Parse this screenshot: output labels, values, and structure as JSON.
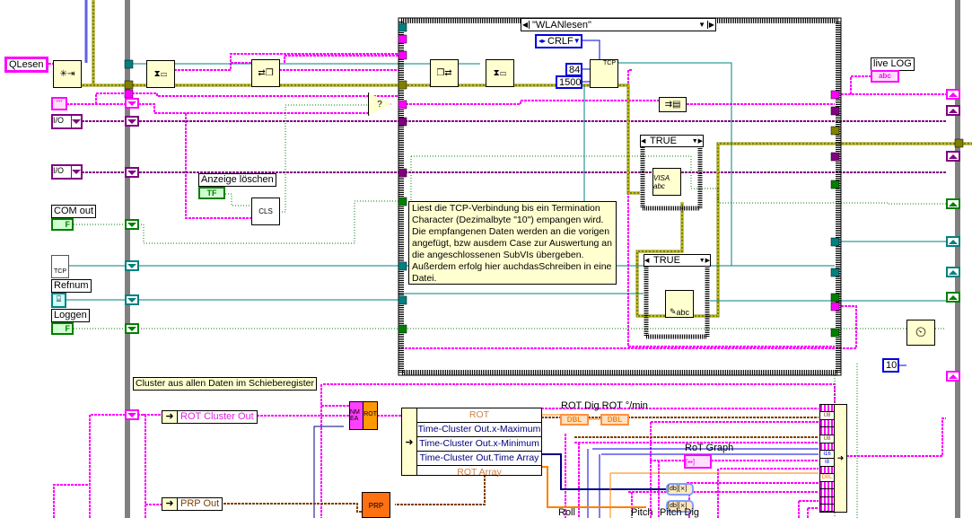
{
  "colors": {
    "string": "#ff00ff",
    "visa": "#800080",
    "error": "#808000",
    "refnum": "#008080",
    "boolean": "#007f00",
    "integer": "#0000e0",
    "double": "#ff8000",
    "cluster": "#804000",
    "loop": "#808080"
  },
  "controls": {
    "qlesen": "QLesen",
    "string_const": "\"\"",
    "io1": "I/O",
    "io2": "I/O",
    "anzeige_label": "Anzeige löschen",
    "anzeige_value": "TF",
    "cls": "CLS",
    "com_out_label": "COM out",
    "com_out_value": "F",
    "tcp_icon": "TCP",
    "refnum_label": "Refnum",
    "loggen_label": "Loggen",
    "loggen_value": "F"
  },
  "case": {
    "selector": "\"WLANlesen\"",
    "crlf": "CRLF",
    "bytes": "84",
    "timeout": "1500",
    "tcp_node": "TCP",
    "inner_case1": "TRUE",
    "inner_case2": "TRUE",
    "visa_node": "VISA abc",
    "write_node": "abc",
    "comment": "Liest die TCP-Verbindung bis ein Termination Character (Dezimalbyte \"10\") empangen wird. Die empfangenen Daten werden  an die vorigen angefügt, bzw ausdem Case zur Auswertung an die angeschlossenen SubVIs übergeben. Außerdem erfolg hier auchdasSchreiben in eine Datei."
  },
  "indicators": {
    "live_log_label": "live LOG",
    "live_log_value": "abc"
  },
  "wait": {
    "value": "10"
  },
  "bottom": {
    "cluster_comment": "Cluster aus allen Daten im Schieberegister",
    "rot_cluster_out": "ROT Cluster Out",
    "prp_out": "PRP Out",
    "nmea_node": "NM EA",
    "rot_node": "ROT",
    "prp_node": "PRP",
    "unbundle_rows": [
      "ROT",
      "Time-Cluster Out.x-Maximum",
      "Time-Cluster Out.x-Minimum",
      "Time-Cluster Out.Time Array",
      "ROT Array"
    ],
    "rot_dig_label": "ROT Dig",
    "rot_min_label": "ROT °/min",
    "dbl1": "DBL",
    "dbl2": "DBL",
    "rot_graph_label": "RoT Graph",
    "roll_label": "Roll",
    "pitch_label": "Pitch",
    "pitch_dig_label": "Pitch Dig",
    "bundle_types": [
      "",
      "U8",
      "",
      "",
      "U8",
      "",
      "I16",
      "I8",
      "",
      "DBL",
      "",
      "",
      "",
      ""
    ]
  }
}
